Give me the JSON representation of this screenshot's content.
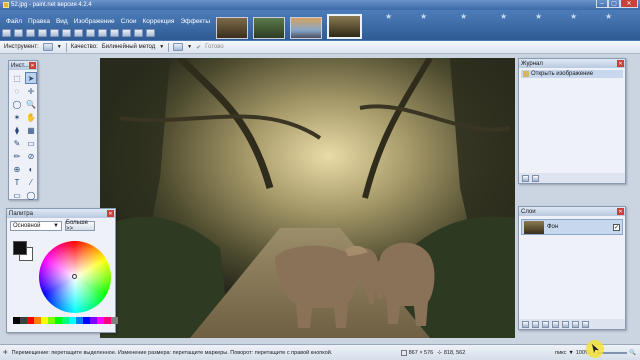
{
  "window": {
    "title": "52.jpg - paint.net версия 4.2.4"
  },
  "menu": [
    "Файл",
    "Правка",
    "Вид",
    "Изображение",
    "Слои",
    "Коррекция",
    "Эффекты"
  ],
  "options_bar": {
    "tool_label": "Инструмент:",
    "quality_label": "Качество:",
    "quality_value": "Билинейный метод",
    "done_label": "Готово"
  },
  "tools_panel": {
    "title": "Инст...",
    "icons": [
      "select-rect",
      "move",
      "lasso",
      "move-selection",
      "ellipse-select",
      "zoom",
      "magic-wand",
      "pan",
      "paint-bucket",
      "gradient",
      "brush",
      "eraser",
      "pencil",
      "color-picker",
      "clone-stamp",
      "recolor",
      "text",
      "line",
      "shapes",
      "ellipse"
    ],
    "glyphs": [
      "⬚",
      "➤",
      "◌",
      "✛",
      "◯",
      "🔍",
      "✶",
      "✋",
      "⧫",
      "▦",
      "✎",
      "▭",
      "✏",
      "⊘",
      "⊕",
      "◐",
      "T",
      "⁄",
      "▭",
      "◯"
    ]
  },
  "palette_panel": {
    "title": "Палитра",
    "mode": "Основной",
    "more_button": "Больше >>",
    "primary_color": "#111111",
    "secondary_color": "#ffffff",
    "swatches": [
      "#000000",
      "#404040",
      "#ff0000",
      "#ff7f00",
      "#ffff00",
      "#7fff00",
      "#00ff00",
      "#00ff7f",
      "#00ffff",
      "#007fff",
      "#0000ff",
      "#7f00ff",
      "#ff00ff",
      "#ff007f",
      "#808080"
    ]
  },
  "history_panel": {
    "title": "Журнал",
    "items": [
      "Открыть изображение"
    ]
  },
  "layers_panel": {
    "title": "Слои",
    "layers": [
      {
        "name": "Фон",
        "visible": true
      }
    ]
  },
  "status": {
    "message": "Перемещение: перетащите выделенное. Изменение размера: перетащите маркеры. Поворот: перетащите с правой кнопкой.",
    "image_size": "867 × 576",
    "cursor_pos": "818, 562",
    "units": "пикс",
    "zoom": "100%"
  },
  "open_images": 4,
  "colors": {
    "title_bar": "#3d6aa8",
    "panel_bg": "#eef2f8",
    "workspace_bg": "#cbd4e1"
  }
}
